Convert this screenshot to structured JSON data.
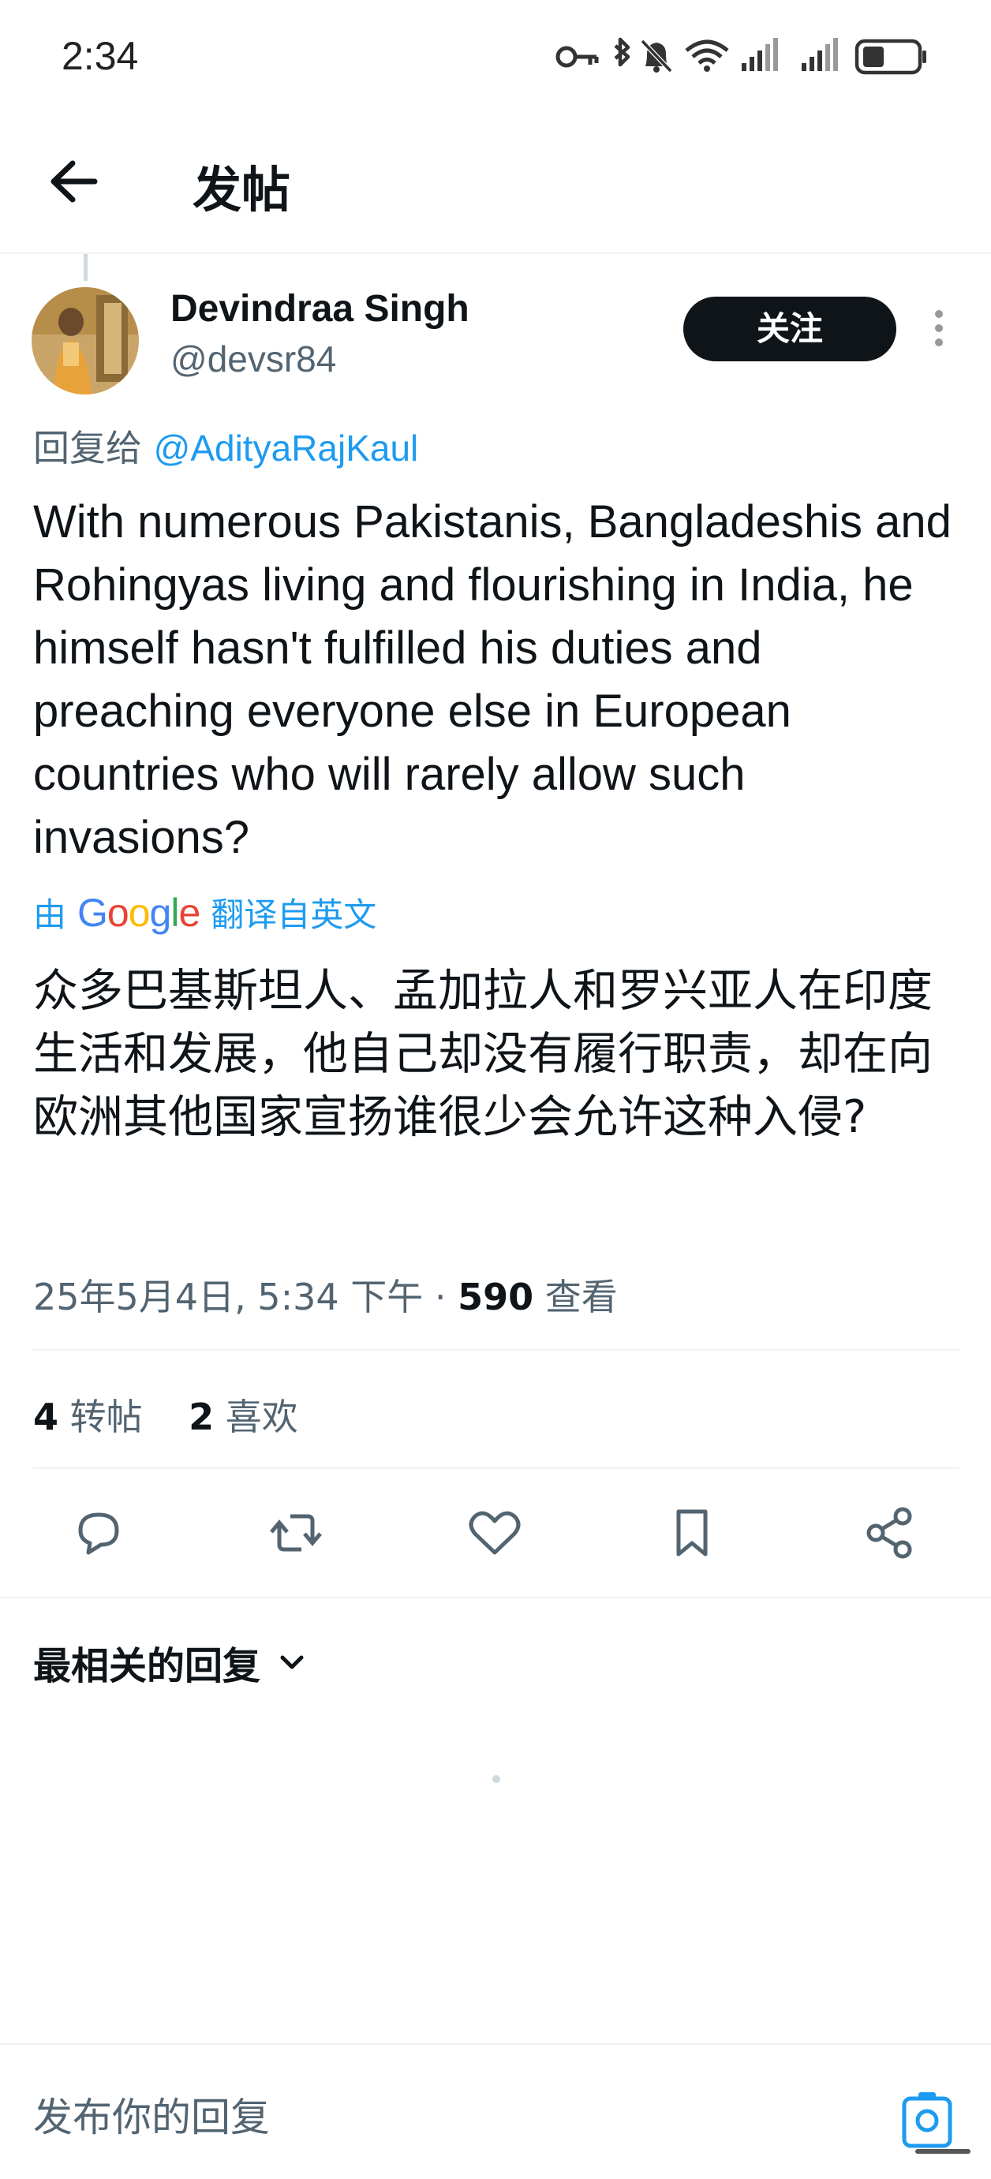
{
  "status_bar": {
    "time": "2:34"
  },
  "topbar": {
    "title": "发帖"
  },
  "post": {
    "author": {
      "display_name": "Devindraa Singh",
      "handle": "@devsr84"
    },
    "follow_label": "关注",
    "reply_prefix": "回复给",
    "reply_mention": "@AdityaRajKaul",
    "text_original": "With numerous Pakistanis, Bangladeshis and Rohingyas living and flourishing in India, he himself hasn't fulfilled his duties and preaching everyone else in European countries who will rarely allow such invasions?",
    "translation": {
      "by_label": "由",
      "provider": "Google",
      "suffix": "翻译自英文"
    },
    "text_translated": "众多巴基斯坦人、孟加拉人和罗兴亚人在印度生活和发展，他自己却没有履行职责，却在向欧洲其他国家宣扬谁很少会允许这种入侵?",
    "timestamp": "25年5月4日, 5:34 下午",
    "separator": "·",
    "views_count": "590",
    "views_label": "查看",
    "stats": {
      "reposts_count": "4",
      "reposts_label": "转帖",
      "likes_count": "2",
      "likes_label": "喜欢"
    }
  },
  "actions": {
    "icons": [
      "reply-icon",
      "repost-icon",
      "like-icon",
      "bookmark-icon",
      "share-icon"
    ]
  },
  "replies": {
    "sort_label": "最相关的回复"
  },
  "composer": {
    "placeholder": "发布你的回复"
  },
  "colors": {
    "accent": "#1d9bf0",
    "text_primary": "#0f1419",
    "text_secondary": "#536471",
    "divider": "#eff3f4",
    "button_dark": "#0f1419"
  }
}
